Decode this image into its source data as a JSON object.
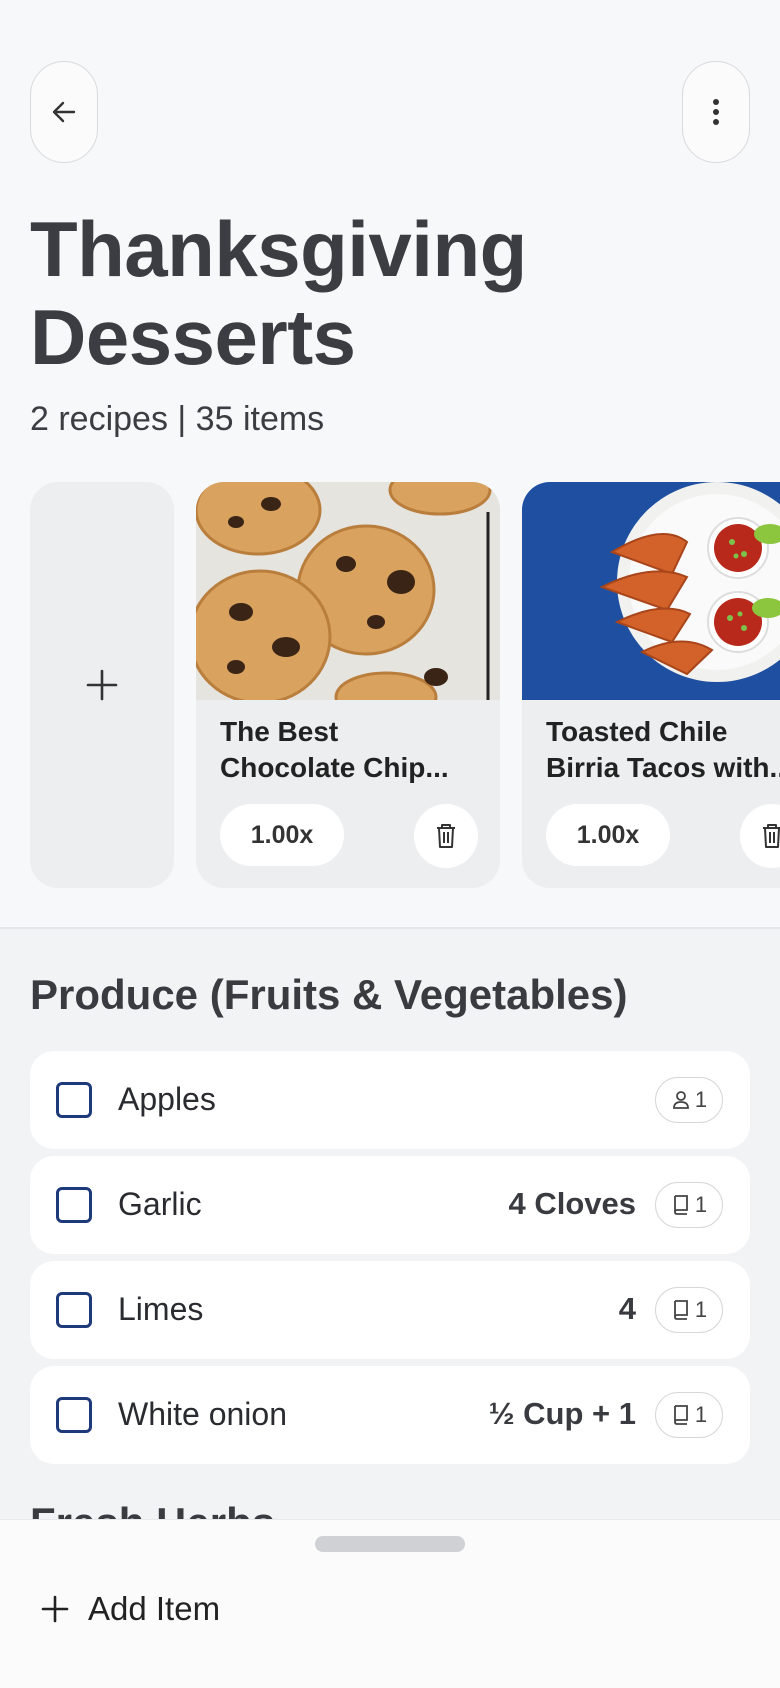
{
  "header": {
    "title_line1": "Thanksgiving",
    "title_line2": "Desserts",
    "summary": "2 recipes | 35 items"
  },
  "recipes": [
    {
      "name_line1": "The Best",
      "name_line2": "Chocolate Chip...",
      "scale": "1.00x"
    },
    {
      "name_line1": "Toasted Chile",
      "name_line2": "Birria Tacos with...",
      "scale": "1.00x"
    }
  ],
  "section": {
    "title": "Produce (Fruits & Vegetables)",
    "items": [
      {
        "name": "Apples",
        "qty": "",
        "badge_icon": "person-icon",
        "badge_count": "1"
      },
      {
        "name": "Garlic",
        "qty": "4 Cloves",
        "badge_icon": "recipe-book-icon",
        "badge_count": "1"
      },
      {
        "name": "Limes",
        "qty": "4",
        "badge_icon": "recipe-book-icon",
        "badge_count": "1"
      },
      {
        "name": "White onion",
        "qty": "½ Cup + 1",
        "badge_icon": "recipe-book-icon",
        "badge_count": "1"
      }
    ],
    "next_title": "Fresh Herbs"
  },
  "bottom": {
    "add_label": "Add Item"
  },
  "colors": {
    "checkbox": "#1f3a7a",
    "background": "#f7f8f9",
    "card": "#eceef0",
    "taco_bg": "#1e4fa0"
  }
}
